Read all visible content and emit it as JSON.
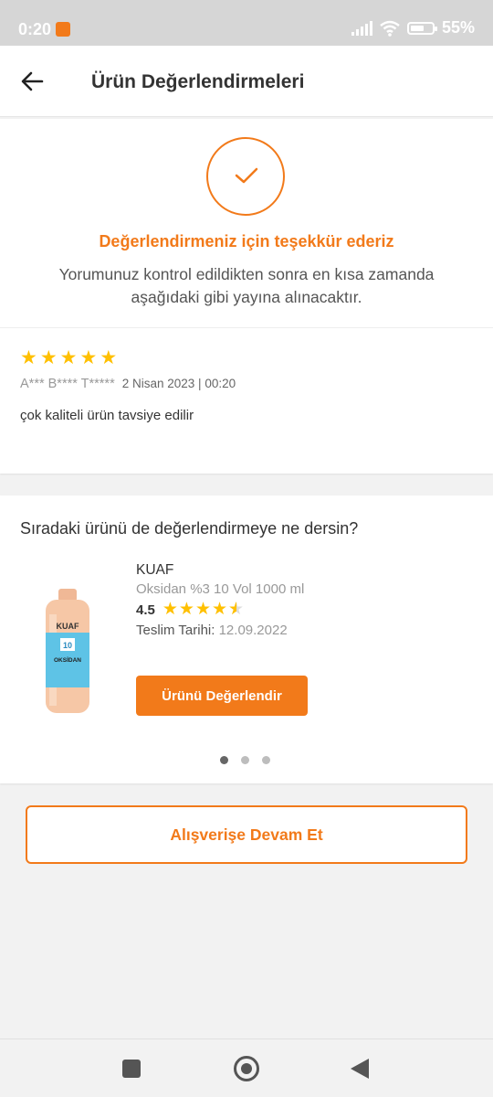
{
  "status_bar": {
    "time": "0:20",
    "battery": "55%"
  },
  "header": {
    "title": "Ürün Değerlendirmeleri"
  },
  "thanks": {
    "title": "Değerlendirmeniz için teşekkür ederiz",
    "description": "Yorumunuz kontrol edildikten sonra en kısa zamanda aşağıdaki gibi yayına alınacaktır."
  },
  "review": {
    "stars": 5,
    "reviewer": "A*** B**** T*****",
    "date": "2 Nisan 2023 | 00:20",
    "comment": "çok kaliteli ürün tavsiye edilir"
  },
  "next_product": {
    "section_title": "Sıradaki ürünü de değerlendirmeye ne dersin?",
    "brand": "KUAF",
    "name": "Oksidan %3 10 Vol 1000 ml",
    "rating": "4.5",
    "rating_value": 4.5,
    "delivery_label": "Teslim Tarihi:",
    "delivery_date": "12.09.2022",
    "button_label": "Ürünü Değerlendir",
    "image_label": "OKSİDAN",
    "image_brand": "KUAF",
    "image_number": "10"
  },
  "pagination": {
    "count": 3,
    "active": 0
  },
  "continue_button": "Alışverişe Devam Et",
  "colors": {
    "accent": "#f27a1a",
    "star": "#ffc000"
  }
}
